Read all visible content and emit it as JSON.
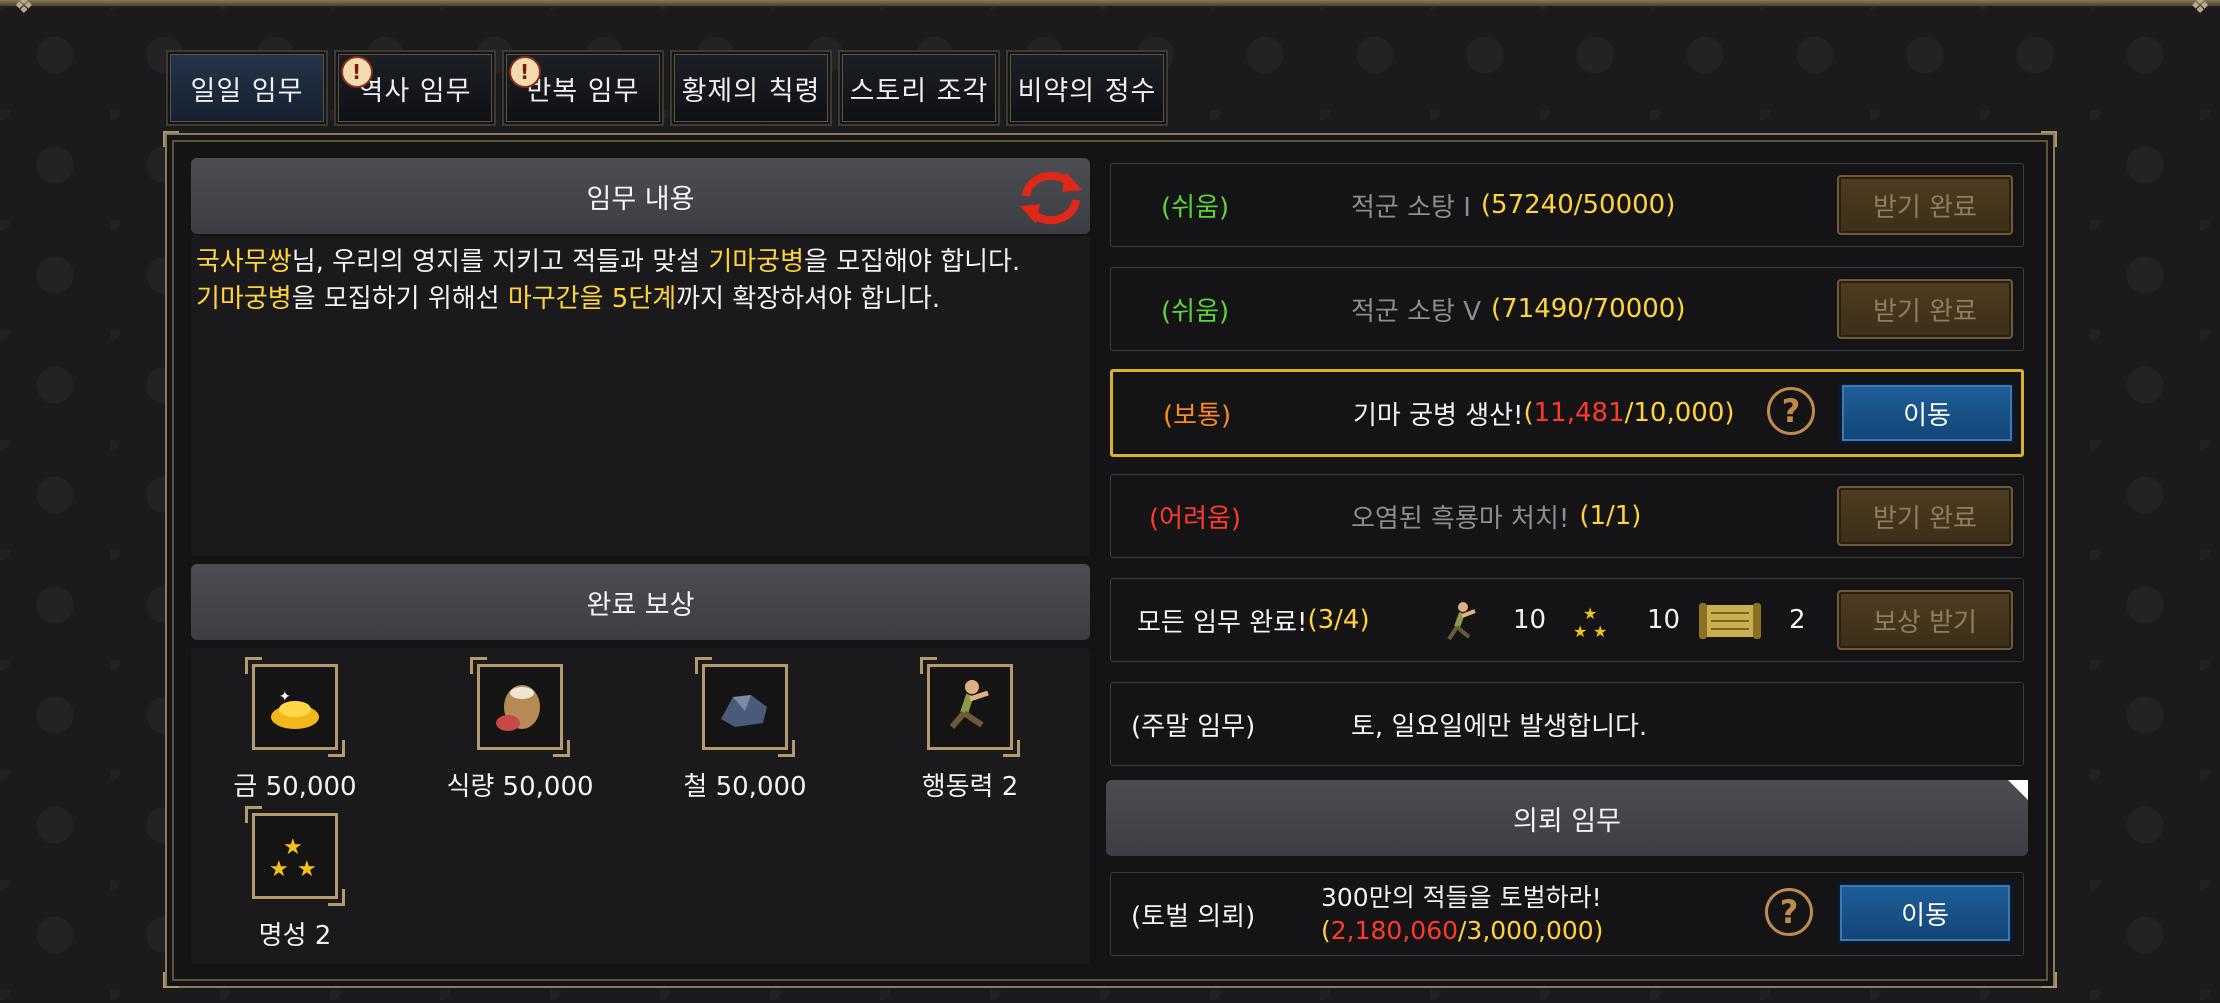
{
  "tabs": [
    {
      "label": "일일 임무",
      "active": true,
      "alert": false
    },
    {
      "label": "역사 임무",
      "active": false,
      "alert": true
    },
    {
      "label": "반복 임무",
      "active": false,
      "alert": true
    },
    {
      "label": "황제의 칙령",
      "active": false,
      "alert": false
    },
    {
      "label": "스토리 조각",
      "active": false,
      "alert": false
    },
    {
      "label": "비약의 정수",
      "active": false,
      "alert": false
    }
  ],
  "alert_mark": "!",
  "mission": {
    "header": "임무 내용",
    "desc_line1": {
      "p1": "국사무쌍",
      "p2": "님, 우리의 영지를 지키고 적들과 맞설 ",
      "p3": "기마궁병",
      "p4": "을 모집해야 합니다."
    },
    "desc_line2": {
      "p1": "기마궁병",
      "p2": "을 모집하기 위해선 ",
      "p3": "마구간을 5단계",
      "p4": "까지 확장하셔야 합니다."
    }
  },
  "rewards": {
    "header": "완료 보상",
    "items": [
      {
        "label": "금 50,000",
        "icon": "gold-icon"
      },
      {
        "label": "식량 50,000",
        "icon": "food-icon"
      },
      {
        "label": "철 50,000",
        "icon": "iron-icon"
      },
      {
        "label": "행동력 2",
        "icon": "stamina-icon"
      },
      {
        "label": "명성 2",
        "icon": "fame-icon"
      }
    ]
  },
  "quests": [
    {
      "difficulty": "(쉬움)",
      "title": "적군 소탕 Ⅰ",
      "progress": "(57240/50000)",
      "button": "받기 완료"
    },
    {
      "difficulty": "(쉬움)",
      "title": "적군 소탕 Ⅴ",
      "progress": "(71490/70000)",
      "button": "받기 완료"
    },
    {
      "difficulty": "(보통)",
      "title": "기마 궁병 생산! ",
      "progress_open": "(",
      "progress_current": "11,481",
      "progress_rest": "/10,000)",
      "button": "이동"
    },
    {
      "difficulty": "(어려움)",
      "title": "오염된 흑룡마 처치!",
      "progress": "(1/1)",
      "button": "받기 완료"
    }
  ],
  "all_complete": {
    "label": "모든 임무 완료! ",
    "progress": "(3/4)",
    "stamina": "10",
    "fame": "10",
    "scroll": "2",
    "button": "보상 받기"
  },
  "weekend": {
    "label": "(주말 임무)",
    "text": "토, 일요일에만 발생합니다."
  },
  "request": {
    "header": "의뢰 임무",
    "label": "(토벌 의뢰)",
    "line1": "300만의 적들을 토벌하라!",
    "progress_open": "(",
    "progress_current": "2,180,060",
    "progress_rest": "/3,000,000)",
    "button": "이동"
  },
  "help_mark": "?",
  "colors": {
    "easy": "#5dd33a",
    "normal": "#ff8a1e",
    "hard": "#ff3a2a",
    "highlight": "#ffd43a",
    "selected_border": "#d9b22a"
  }
}
